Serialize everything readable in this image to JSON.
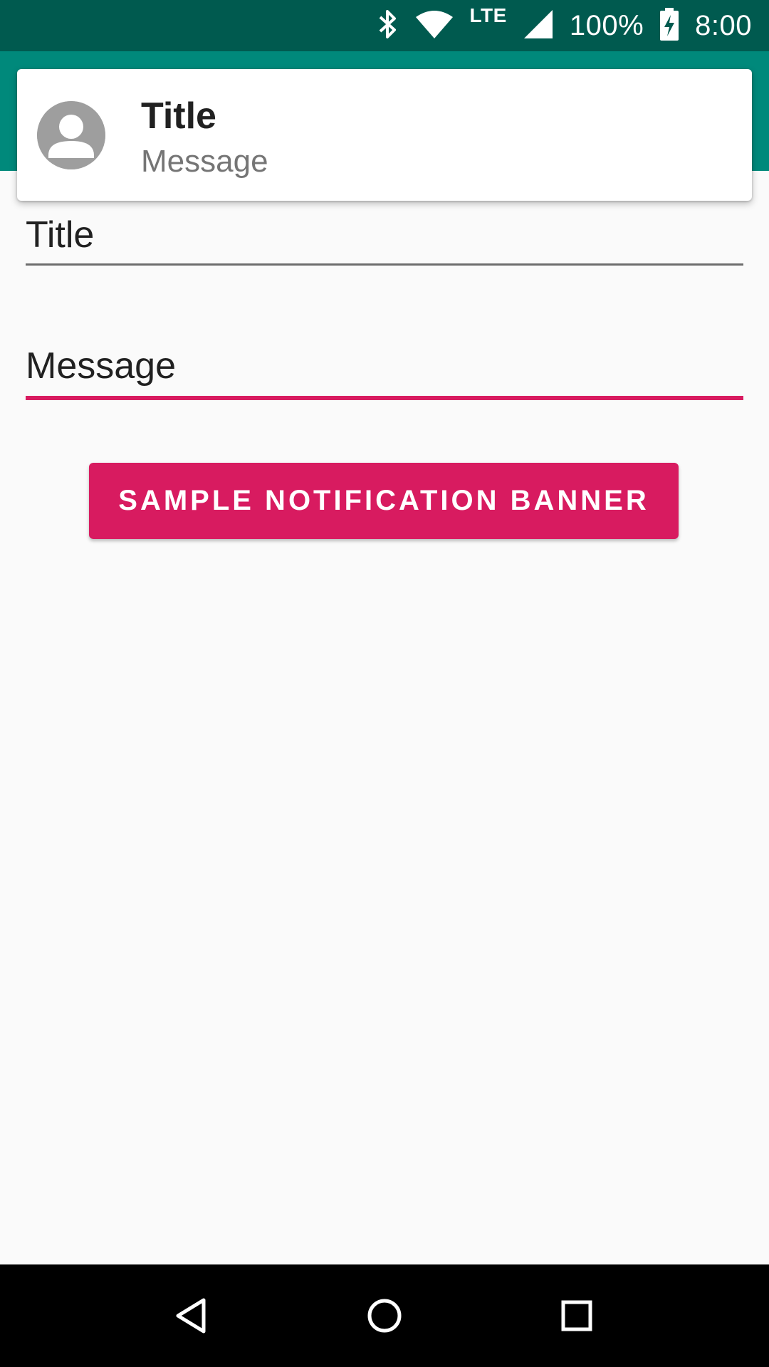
{
  "status_bar": {
    "battery": "100%",
    "time": "8:00",
    "network": "LTE",
    "icons": [
      "bluetooth-icon",
      "wifi-icon",
      "lte-icon",
      "cell-signal-icon",
      "battery-charging-icon"
    ],
    "background": "#005a4f"
  },
  "app_bar": {
    "background": "#00897b"
  },
  "banner": {
    "title": "Title",
    "message": "Message",
    "avatar_icon": "person-avatar-icon"
  },
  "form": {
    "title_field": {
      "value": "Title"
    },
    "message_field": {
      "value": "Message"
    }
  },
  "actions": {
    "sample_button_label": "SAMPLE NOTIFICATION BANNER"
  },
  "nav_bar": {
    "icons": [
      "back-icon",
      "home-icon",
      "recents-icon"
    ]
  },
  "colors": {
    "accent": "#d81b60",
    "primary": "#00897b",
    "primary_dark": "#005a4f",
    "background": "#fafafa"
  }
}
